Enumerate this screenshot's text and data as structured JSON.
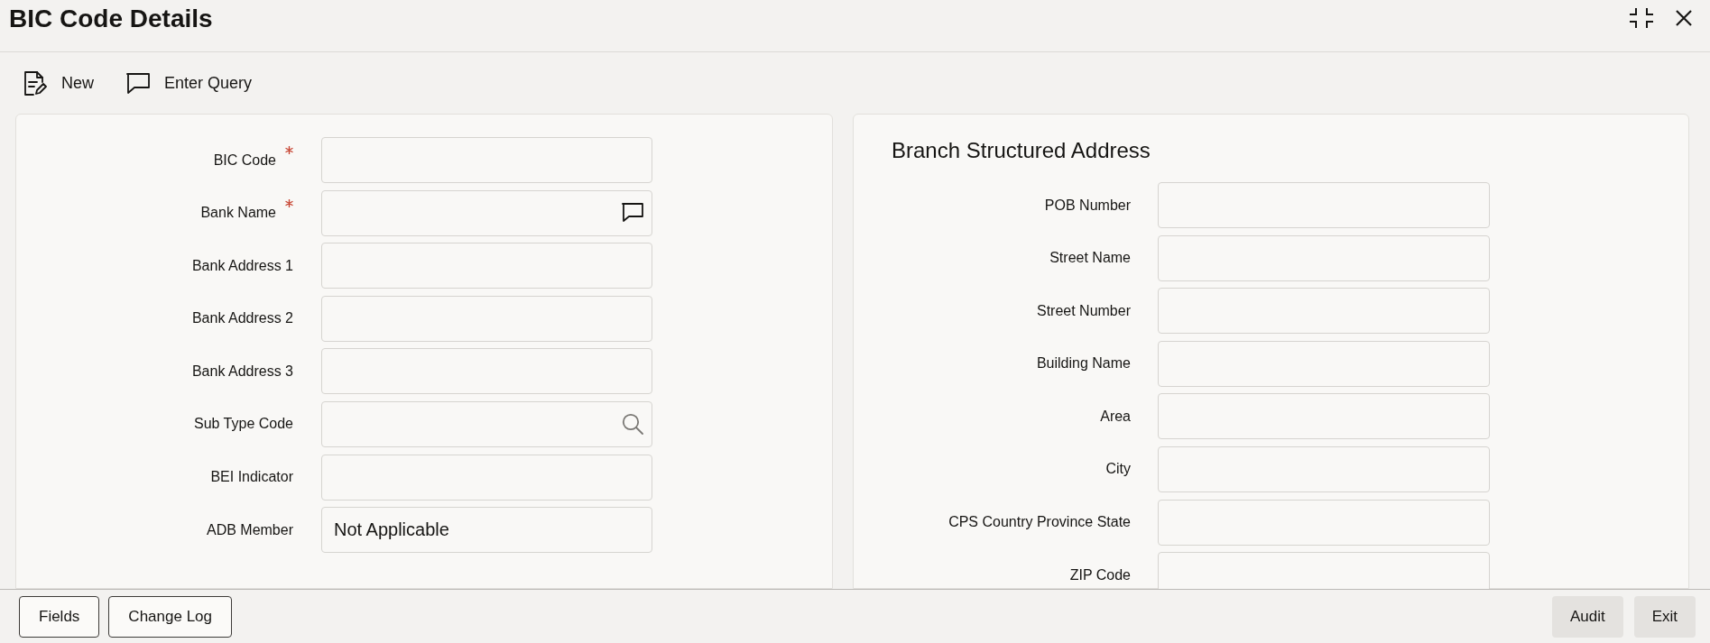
{
  "window": {
    "title": "BIC Code Details"
  },
  "toolbar": [
    {
      "label": "New",
      "kind": "new"
    },
    {
      "label": "Enter Query",
      "kind": "query"
    }
  ],
  "main_form": {
    "fields": [
      {
        "label": "BIC Code",
        "required": true,
        "kind": "text"
      },
      {
        "label": "Bank Name",
        "required": true,
        "kind": "comment"
      },
      {
        "label": "Bank Address 1",
        "required": false,
        "kind": "text"
      },
      {
        "label": "Bank Address 2",
        "required": false,
        "kind": "text"
      },
      {
        "label": "Bank Address 3",
        "required": false,
        "kind": "text"
      },
      {
        "label": "Sub Type Code",
        "required": false,
        "kind": "lookup"
      },
      {
        "label": "BEI Indicator",
        "required": false,
        "kind": "text"
      },
      {
        "label": "ADB Member",
        "required": false,
        "kind": "text",
        "value": "Not Applicable"
      }
    ]
  },
  "branch_structured_address": {
    "title": "Branch Structured Address",
    "fields": [
      {
        "label": "POB Number"
      },
      {
        "label": "Street Name"
      },
      {
        "label": "Street Number"
      },
      {
        "label": "Building Name"
      },
      {
        "label": "Area"
      },
      {
        "label": "City"
      },
      {
        "label": "CPS Country Province State"
      },
      {
        "label": "ZIP Code"
      }
    ]
  },
  "footer": {
    "left_buttons": [
      "Fields",
      "Change Log"
    ],
    "right_buttons": [
      "Audit",
      "Exit"
    ]
  }
}
